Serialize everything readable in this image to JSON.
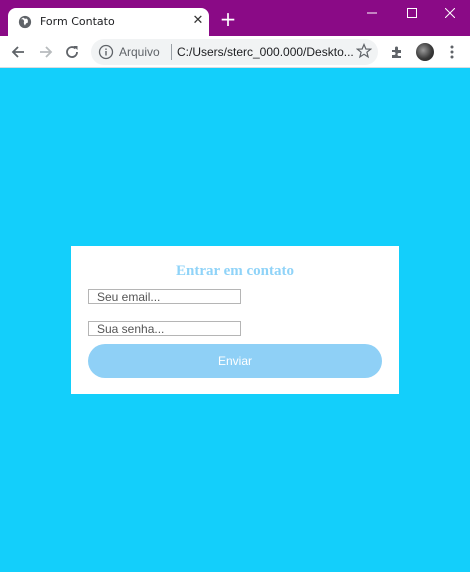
{
  "browser": {
    "tab": {
      "title": "Form Contato",
      "close_glyph": "✕",
      "icon": "globe-icon"
    },
    "new_tab_glyph": "+",
    "omnibox": {
      "scheme_label": "Arquivo",
      "url": "C:/Users/sterc_000.000/Deskto..."
    },
    "colors": {
      "titlebar": "#8a0a86",
      "page_background": "#13cffb"
    }
  },
  "form": {
    "title": "Entrar em contato",
    "email_placeholder": "Seu email...",
    "password_placeholder": "Sua senha...",
    "submit_label": "Enviar",
    "colors": {
      "accent": "#8fd3f8",
      "button": "#8fd0f6"
    }
  }
}
